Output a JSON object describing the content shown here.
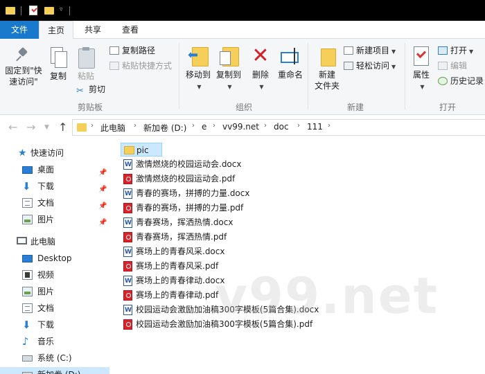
{
  "quick_access_toolbar": {
    "icons": [
      "folder-icon",
      "properties-icon",
      "new-folder-icon",
      "customize-dropdown-icon"
    ]
  },
  "ribbon_tabs": [
    "文件",
    "主页",
    "共享",
    "查看"
  ],
  "ribbon": {
    "clipboard": {
      "pin_label": "固定到\"快速访问\"",
      "copy_label": "复制",
      "paste_label": "粘贴",
      "copy_path_label": "复制路径",
      "paste_shortcut_label": "粘贴快捷方式",
      "cut_label": "剪切",
      "group_label": "剪贴板"
    },
    "organize": {
      "move_to_label": "移动到",
      "copy_to_label": "复制到",
      "delete_label": "删除",
      "rename_label": "重命名",
      "group_label": "组织"
    },
    "new": {
      "new_folder_label": "新建\n文件夹",
      "new_item_label": "新建项目",
      "easy_access_label": "轻松访问",
      "group_label": "新建"
    },
    "open": {
      "properties_label": "属性",
      "open_label": "打开",
      "edit_label": "编辑",
      "history_label": "历史记录",
      "group_label": "打开"
    }
  },
  "address_bar": {
    "breadcrumbs": [
      "此电脑",
      "新加卷 (D:)",
      "e",
      "vv99.net",
      "doc",
      "111"
    ]
  },
  "nav_pane": {
    "quick_access_label": "快速访问",
    "quick_items": [
      "桌面",
      "下载",
      "文档",
      "图片"
    ],
    "this_pc_label": "此电脑",
    "pc_items": [
      "Desktop",
      "视频",
      "图片",
      "文档",
      "下载",
      "音乐",
      "系统 (C:)",
      "新加卷 (D:)"
    ]
  },
  "files": [
    {
      "name": "pic",
      "type": "folder"
    },
    {
      "name": "激情燃烧的校园运动会.docx",
      "type": "docx"
    },
    {
      "name": "激情燃烧的校园运动会.pdf",
      "type": "pdf"
    },
    {
      "name": "青春的赛场，拼搏的力量.docx",
      "type": "docx"
    },
    {
      "name": "青春的赛场，拼搏的力量.pdf",
      "type": "pdf"
    },
    {
      "name": "青春赛场，挥洒热情.docx",
      "type": "docx"
    },
    {
      "name": "青春赛场，挥洒热情.pdf",
      "type": "pdf"
    },
    {
      "name": "赛场上的青春风采.docx",
      "type": "docx"
    },
    {
      "name": "赛场上的青春风采.pdf",
      "type": "pdf"
    },
    {
      "name": "赛场上的青春律动.docx",
      "type": "docx"
    },
    {
      "name": "赛场上的青春律动.pdf",
      "type": "pdf"
    },
    {
      "name": "校园运动会激励加油稿300字模板(5篇合集).docx",
      "type": "docx"
    },
    {
      "name": "校园运动会激励加油稿300字模板(5篇合集).pdf",
      "type": "pdf"
    }
  ],
  "watermark_text": "v99.net"
}
